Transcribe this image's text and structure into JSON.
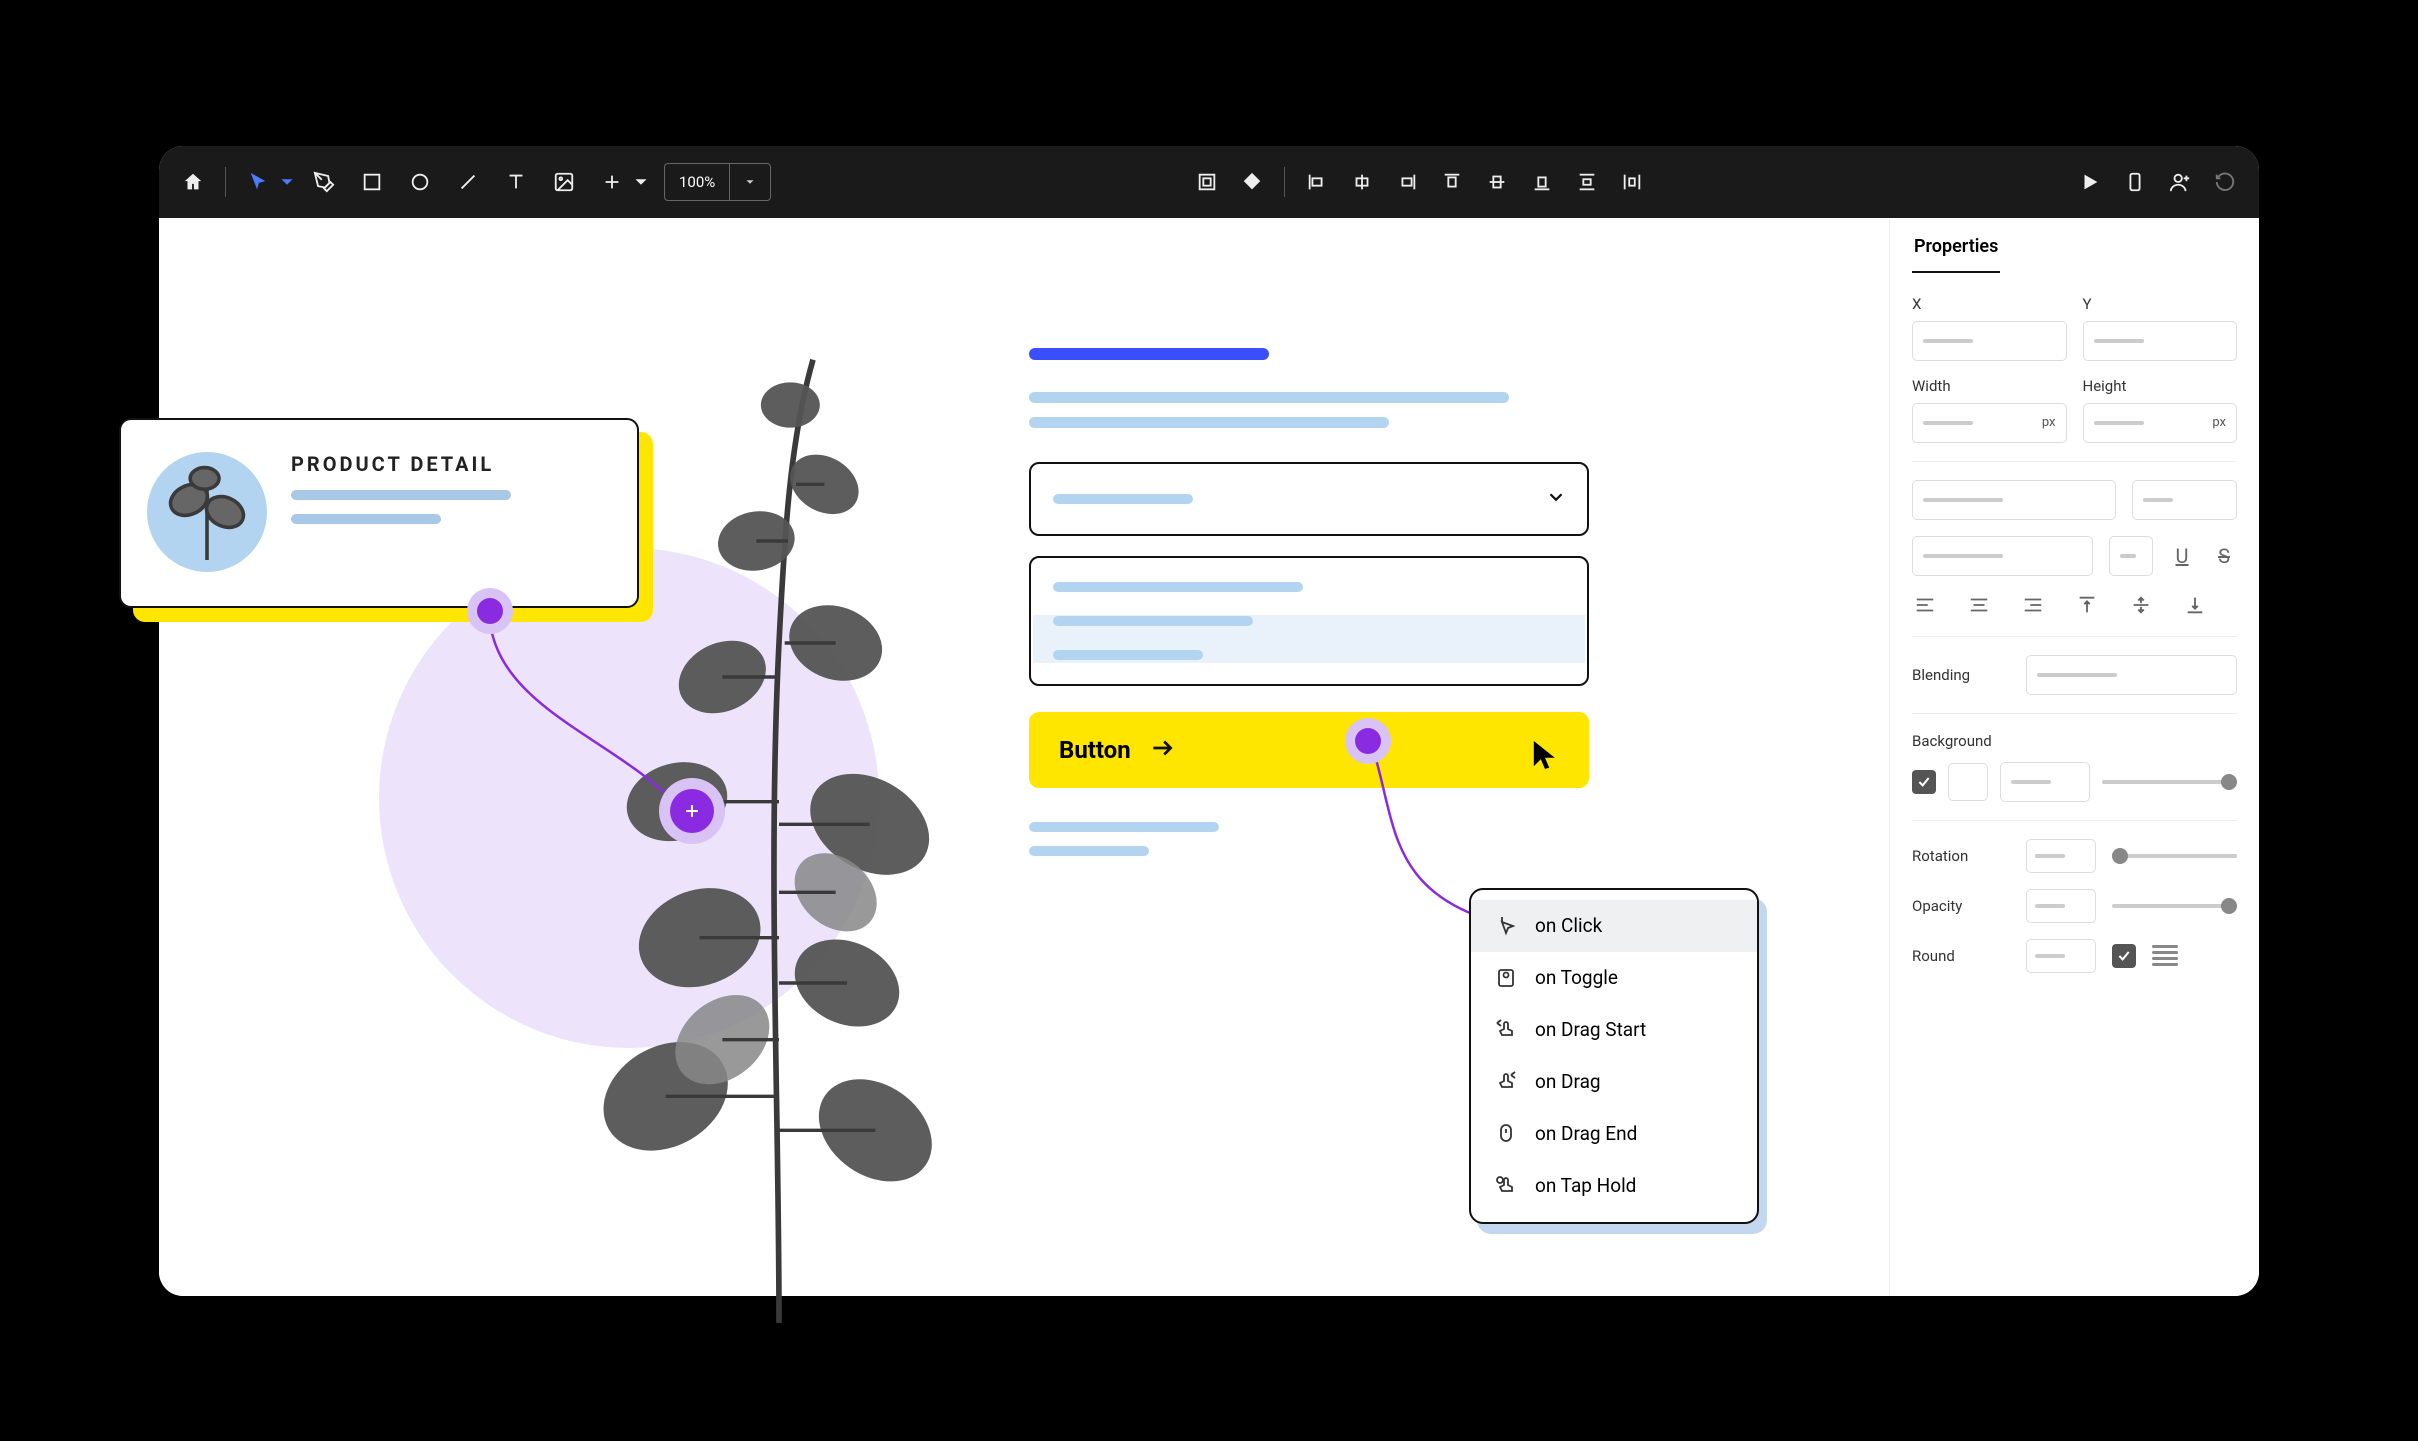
{
  "toolbar": {
    "zoom": "100%"
  },
  "popup": {
    "title": "PRODUCT DETAIL"
  },
  "form": {
    "button_label": "Button"
  },
  "events": [
    {
      "label": "on Click",
      "selected": true
    },
    {
      "label": "on Toggle"
    },
    {
      "label": "on Drag Start"
    },
    {
      "label": "on Drag"
    },
    {
      "label": "on Drag End"
    },
    {
      "label": "on Tap Hold"
    }
  ],
  "props": {
    "tab": "Properties",
    "x_label": "X",
    "y_label": "Y",
    "width_label": "Width",
    "height_label": "Height",
    "width_unit": "px",
    "height_unit": "px",
    "underline_glyph": "U",
    "strike_glyph": "S",
    "blending_label": "Blending",
    "background_label": "Background",
    "rotation_label": "Rotation",
    "opacity_label": "Opacity",
    "round_label": "Round"
  }
}
